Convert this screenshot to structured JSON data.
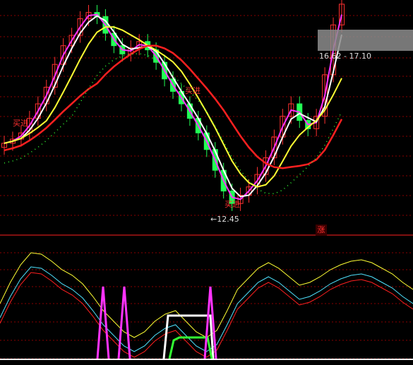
{
  "chart_data": [
    {
      "type": "candlestick",
      "panel": "main",
      "annotations": {
        "buy_label": "买进",
        "low_price_label": "12.45",
        "range_label": "16.62 - 17.10"
      },
      "candles_close_path": [
        {
          "i": 0,
          "close": 13.95
        },
        {
          "i": 1,
          "close": 14.05
        },
        {
          "i": 2,
          "close": 14.2
        },
        {
          "i": 3,
          "close": 14.55
        },
        {
          "i": 4,
          "close": 14.9
        },
        {
          "i": 5,
          "close": 15.3
        },
        {
          "i": 6,
          "close": 15.85
        },
        {
          "i": 7,
          "close": 16.3
        },
        {
          "i": 8,
          "close": 16.55
        },
        {
          "i": 9,
          "close": 16.95
        },
        {
          "i": 10,
          "close": 17.1
        },
        {
          "i": 11,
          "close": 17.0
        },
        {
          "i": 12,
          "close": 16.6
        },
        {
          "i": 13,
          "close": 16.3
        },
        {
          "i": 14,
          "close": 16.1
        },
        {
          "i": 15,
          "close": 16.25
        },
        {
          "i": 16,
          "close": 16.4
        },
        {
          "i": 17,
          "close": 16.2
        },
        {
          "i": 18,
          "close": 15.9
        },
        {
          "i": 19,
          "close": 15.5
        },
        {
          "i": 20,
          "close": 15.2
        },
        {
          "i": 21,
          "close": 14.9
        },
        {
          "i": 22,
          "close": 14.55
        },
        {
          "i": 23,
          "close": 14.2
        },
        {
          "i": 24,
          "close": 13.8
        },
        {
          "i": 25,
          "close": 13.3
        },
        {
          "i": 26,
          "close": 12.8
        },
        {
          "i": 27,
          "close": 12.5
        },
        {
          "i": 28,
          "close": 12.7
        },
        {
          "i": 29,
          "close": 12.9
        },
        {
          "i": 30,
          "close": 13.2
        },
        {
          "i": 31,
          "close": 13.6
        },
        {
          "i": 32,
          "close": 14.1
        },
        {
          "i": 33,
          "close": 14.6
        },
        {
          "i": 34,
          "close": 14.9
        },
        {
          "i": 35,
          "close": 14.5
        },
        {
          "i": 36,
          "close": 14.3
        },
        {
          "i": 37,
          "close": 14.6
        },
        {
          "i": 38,
          "close": 15.6
        },
        {
          "i": 39,
          "close": 16.8
        },
        {
          "i": 40,
          "close": 17.3
        }
      ]
    },
    {
      "type": "line",
      "panel": "indicator",
      "series_colors": {
        "white_line": "#ffffff",
        "yellow_line": "#ffff33",
        "cyan_line": "#4fe3ff",
        "red_line": "#ff2020",
        "magenta_spike": "#ff33ff",
        "green_step": "#33ff33"
      }
    }
  ],
  "colors": {
    "background": "#000000",
    "grid": "#8a0000",
    "up_candle": "#ff3030",
    "down_candle": "#22ff55",
    "ma_white": "#ffffff",
    "ma_yellow": "#ffff33",
    "ma_magenta": "#ff33ff",
    "ma_red": "#ff2020",
    "dotted_green": "#33ff33",
    "sar_cyan": "#4fe3ff"
  },
  "badge": {
    "text": "涨"
  }
}
